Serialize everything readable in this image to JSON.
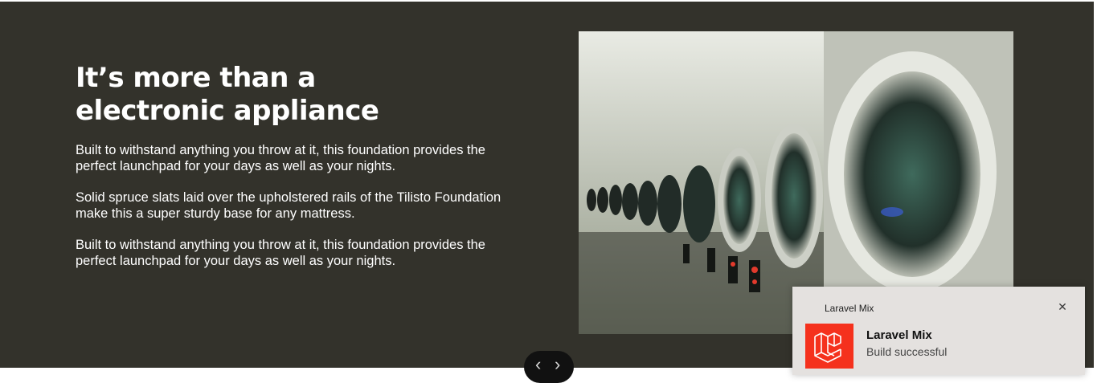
{
  "hero": {
    "headline_line1": "It’s more than a",
    "headline_line2": "electronic appliance",
    "paragraphs": [
      "Built to withstand anything you throw at it, this foundation provides the perfect launchpad for your days as well as your nights.",
      "Solid spruce slats laid over the upholstered rails of the Tilisto Foundation make this a super sturdy base for any mattress.",
      "Built to withstand anything you throw at it, this foundation provides the perfect launchpad for your days as well as your nights."
    ],
    "background_color": "#33322b"
  },
  "image": {
    "description_icon": "laundromat-washing-machines-photo"
  },
  "carousel": {
    "prev_icon": "chevron-left-icon",
    "next_icon": "chevron-right-icon"
  },
  "notification": {
    "app_name": "Laravel Mix",
    "title": "Laravel Mix",
    "message": "Build successful",
    "close_icon": "close-icon",
    "logo_icon": "laravel-logo-icon",
    "logo_color": "#f5311d"
  }
}
